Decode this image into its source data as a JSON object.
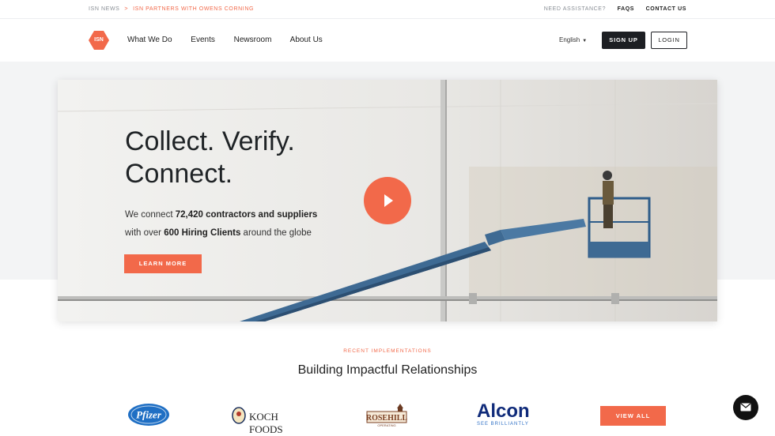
{
  "topbar": {
    "news_label": "ISN NEWS",
    "separator": ">",
    "news_link": "ISN PARTNERS WITH OWENS CORNING",
    "assist": "NEED ASSISTANCE?",
    "faqs": "FAQS",
    "contact": "CONTACT US"
  },
  "nav": {
    "logo_text": "ISN",
    "items": [
      "What We Do",
      "Events",
      "Newsroom",
      "About Us"
    ],
    "language": "English",
    "signup": "SIGN UP",
    "login": "LOGIN"
  },
  "hero": {
    "headline_1": "Collect. Verify.",
    "headline_2": "Connect.",
    "sub_1_pre": "We connect ",
    "sub_1_bold": "72,420 contractors and suppliers",
    "sub_2_pre": "with over ",
    "sub_2_bold": "600 Hiring Clients",
    "sub_2_post": " around the globe",
    "cta": "LEARN MORE"
  },
  "implementations": {
    "eyebrow": "RECENT IMPLEMENTATIONS",
    "title": "Building Impactful Relationships",
    "logos": {
      "pfizer": "Pfizer",
      "koch": "KOCH FOODS",
      "rosehill": "ROSEHILL",
      "rosehill_sub": "OPERATING",
      "alcon": "Alcon",
      "alcon_tag": "SEE BRILLIANTLY"
    },
    "view_all": "VIEW ALL"
  },
  "colors": {
    "accent": "#f2694a",
    "dark": "#1d1f23",
    "alcon_blue": "#102b7a"
  }
}
